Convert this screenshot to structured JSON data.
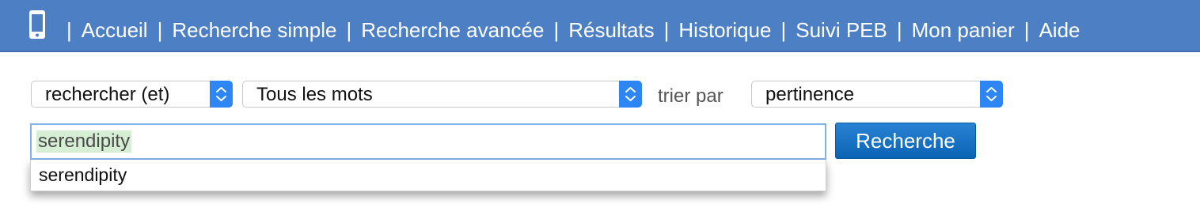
{
  "nav": {
    "items": [
      {
        "label": "Accueil"
      },
      {
        "label": "Recherche simple"
      },
      {
        "label": "Recherche avancée"
      },
      {
        "label": "Résultats"
      },
      {
        "label": "Historique"
      },
      {
        "label": "Suivi PEB"
      },
      {
        "label": "Mon panier"
      },
      {
        "label": "Aide"
      }
    ],
    "separator": "|",
    "icon": "mobile-phone-icon"
  },
  "search": {
    "operator_select": "rechercher (et)",
    "scope_select": "Tous les mots",
    "sort_label": "trier par",
    "sort_select": "pertinence",
    "query": "serendipity",
    "suggestions": [
      "serendipity"
    ],
    "button_label": "Recherche"
  },
  "colors": {
    "nav_background": "#4d7fc4",
    "select_arrow": "#2d86f4",
    "button": "#0b63b4",
    "query_highlight": "#d6efd4",
    "input_focus_border": "#82b2ea"
  }
}
